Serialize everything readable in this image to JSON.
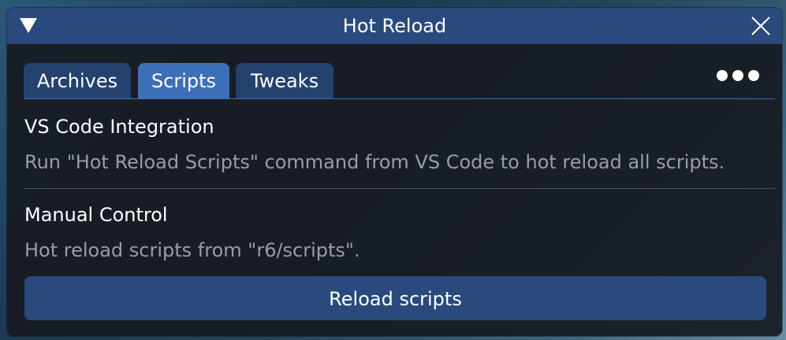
{
  "window": {
    "title": "Hot Reload",
    "collapse_icon": "triangle-down-icon",
    "close_icon": "close-icon"
  },
  "tabs": [
    {
      "label": "Archives",
      "active": false
    },
    {
      "label": "Scripts",
      "active": true
    },
    {
      "label": "Tweaks",
      "active": false
    }
  ],
  "more_icon": "more-horizontal-icon",
  "sections": [
    {
      "heading": "VS Code Integration",
      "description": "Run \"Hot Reload Scripts\" command from VS Code to hot reload all scripts."
    },
    {
      "heading": "Manual Control",
      "description": "Hot reload scripts from \"r6/scripts\"."
    }
  ],
  "reload_button": {
    "label": "Reload scripts"
  },
  "colors": {
    "titlebar": "#2a4a7e",
    "tab_active": "#3d6fb8",
    "tab_inactive": "#25426f",
    "window_bg": "#181b21",
    "text_primary": "#ffffff",
    "text_muted": "#9a9da2"
  }
}
